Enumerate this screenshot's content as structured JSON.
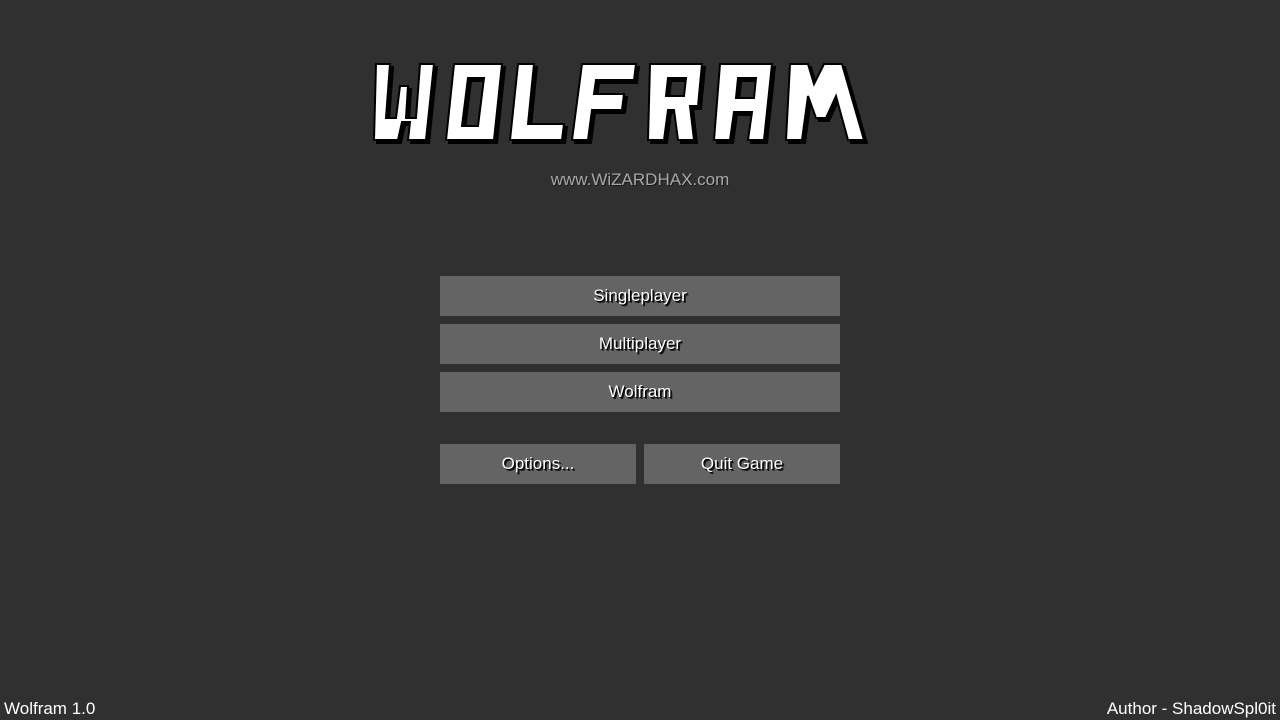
{
  "title_logo": {
    "text": "WOLFRAM",
    "fill_color": "#ffffff",
    "outline_color": "#000000"
  },
  "subtitle": "www.WiZARDHAX.com",
  "menu": {
    "singleplayer": "Singleplayer",
    "multiplayer": "Multiplayer",
    "wolfram": "Wolfram",
    "options": "Options...",
    "quit": "Quit Game"
  },
  "footer": {
    "version": "Wolfram 1.0",
    "author": "Author - ShadowSpl0it"
  },
  "colors": {
    "background": "#303030",
    "button": "#646464",
    "subtitle": "#a8a8a8"
  }
}
